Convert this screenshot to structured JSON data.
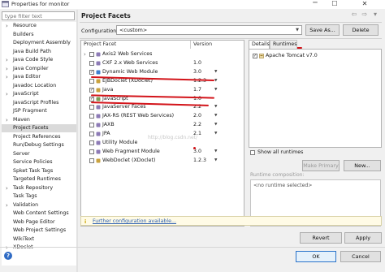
{
  "window": {
    "title": "Properties for monitor",
    "minimize_glyph": "─",
    "maximize_glyph": "☐",
    "close_glyph": "✕"
  },
  "sidebar": {
    "filter_placeholder": "type filter text",
    "items": [
      {
        "label": "Resource",
        "expandable": true
      },
      {
        "label": "Builders",
        "expandable": false
      },
      {
        "label": "Deployment Assembly",
        "expandable": false
      },
      {
        "label": "Java Build Path",
        "expandable": false
      },
      {
        "label": "Java Code Style",
        "expandable": true
      },
      {
        "label": "Java Compiler",
        "expandable": true
      },
      {
        "label": "Java Editor",
        "expandable": true
      },
      {
        "label": "Javadoc Location",
        "expandable": false
      },
      {
        "label": "JavaScript",
        "expandable": true
      },
      {
        "label": "JavaScript Profiles",
        "expandable": false
      },
      {
        "label": "JSP Fragment",
        "expandable": false
      },
      {
        "label": "Maven",
        "expandable": true
      },
      {
        "label": "Project Facets",
        "expandable": false,
        "selected": true
      },
      {
        "label": "Project References",
        "expandable": false
      },
      {
        "label": "Run/Debug Settings",
        "expandable": false
      },
      {
        "label": "Server",
        "expandable": false
      },
      {
        "label": "Service Policies",
        "expandable": false
      },
      {
        "label": "Spket Task Tags",
        "expandable": false
      },
      {
        "label": "Targeted Runtimes",
        "expandable": false
      },
      {
        "label": "Task Repository",
        "expandable": true
      },
      {
        "label": "Task Tags",
        "expandable": false
      },
      {
        "label": "Validation",
        "expandable": true
      },
      {
        "label": "Web Content Settings",
        "expandable": false
      },
      {
        "label": "Web Page Editor",
        "expandable": false
      },
      {
        "label": "Web Project Settings",
        "expandable": false
      },
      {
        "label": "WikiText",
        "expandable": false
      },
      {
        "label": "XDoclet",
        "expandable": true
      }
    ]
  },
  "page": {
    "title": "Project Facets",
    "back_glyph": "⇦",
    "forward_glyph": "⇨",
    "menu_glyph": "▾"
  },
  "configuration": {
    "label": "Configuration:",
    "value": "<custom>",
    "save_as_label": "Save As...",
    "delete_label": "Delete"
  },
  "facets": {
    "col_facet": "Project Facet",
    "col_version": "Version",
    "rows": [
      {
        "name": "Axis2 Web Services",
        "version": "",
        "checked": false,
        "expandable": true,
        "icon_color": "#8d7bb6"
      },
      {
        "name": "CXF 2.x Web Services",
        "version": "1.0",
        "checked": false,
        "expandable": false,
        "icon_color": "#8d7bb6"
      },
      {
        "name": "Dynamic Web Module",
        "version": "3.0",
        "checked": true,
        "expandable": false,
        "icon_color": "#3f7fd0",
        "has_dropdown": true
      },
      {
        "name": "EJBDoclet (XDoclet)",
        "version": "1.2.3",
        "checked": false,
        "expandable": false,
        "icon_color": "#c9a23f",
        "has_dropdown": true
      },
      {
        "name": "Java",
        "version": "1.7",
        "checked": true,
        "expandable": false,
        "icon_color": "#c9a23f",
        "has_dropdown": true
      },
      {
        "name": "JavaScript",
        "version": "1.0",
        "checked": true,
        "expandable": false,
        "icon_color": "#7aa05a"
      },
      {
        "name": "JavaServer Faces",
        "version": "2.2",
        "checked": false,
        "expandable": false,
        "icon_color": "#8d7bb6",
        "has_dropdown": true
      },
      {
        "name": "JAX-RS (REST Web Services)",
        "version": "2.0",
        "checked": false,
        "expandable": false,
        "icon_color": "#8d7bb6",
        "has_dropdown": true
      },
      {
        "name": "JAXB",
        "version": "2.2",
        "checked": false,
        "expandable": false,
        "icon_color": "#8d7bb6",
        "has_dropdown": true
      },
      {
        "name": "JPA",
        "version": "2.1",
        "checked": false,
        "expandable": false,
        "icon_color": "#8d7bb6",
        "has_dropdown": true
      },
      {
        "name": "Utility Module",
        "version": "",
        "checked": false,
        "expandable": false,
        "icon_color": "#8d7bb6"
      },
      {
        "name": "Web Fragment Module",
        "version": "3.0",
        "checked": false,
        "expandable": false,
        "icon_color": "#8d7bb6",
        "has_dropdown": true
      },
      {
        "name": "WebDoclet (XDoclet)",
        "version": "1.2.3",
        "checked": false,
        "expandable": false,
        "icon_color": "#c9a23f",
        "has_dropdown": true
      }
    ],
    "watermark": "http://blog.csdn.net/"
  },
  "details": {
    "tab_details": "Details",
    "tab_runtimes": "Runtimes",
    "runtime_name": "Apache Tomcat v7.0",
    "runtime_checked": true,
    "show_all_label": "Show all runtimes",
    "make_primary_label": "Make Primary",
    "new_label": "New...",
    "composition_label": "Runtime composition:",
    "composition_empty": "<no runtime selected>"
  },
  "info": {
    "icon": "i",
    "link_text": "Further configuration available..."
  },
  "buttons": {
    "revert": "Revert",
    "apply": "Apply",
    "ok": "OK",
    "cancel": "Cancel",
    "help_glyph": "?"
  },
  "colors": {
    "annotation_red": "#d3141a",
    "selection_gray": "#dadada",
    "link_blue": "#2a5db0"
  }
}
